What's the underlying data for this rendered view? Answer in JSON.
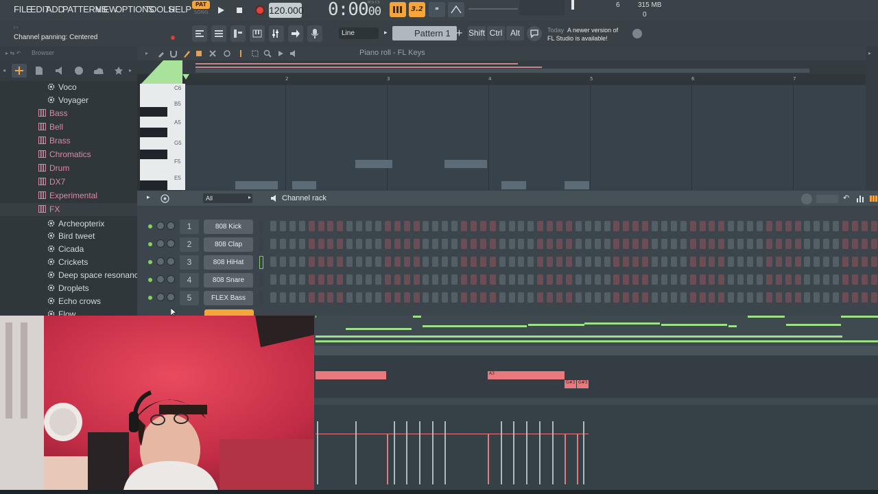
{
  "menu": [
    "FILE",
    "EDIT",
    "ADD",
    "PATTERNS",
    "VIEW",
    "OPTIONS",
    "TOOLS",
    "HELP"
  ],
  "transport": {
    "pat_label": "PAT",
    "song_label": "SONG",
    "tempo": "120.000",
    "time_main": "0:00",
    "time_ms": "00",
    "time_unit": "M:S:CS"
  },
  "toolbar_buttons": {
    "typing": "3.2",
    "wait": "⚭"
  },
  "monitor": {
    "cpu": "6",
    "memory": "315 MB",
    "polyphony": "0"
  },
  "hint": {
    "prefix": "ı  ı",
    "text": "Channel panning: Centered"
  },
  "snap": {
    "value": "Line"
  },
  "pattern": {
    "name": "Pattern 1",
    "add": "+"
  },
  "modifiers": [
    "Shift",
    "Ctrl",
    "Alt"
  ],
  "news": {
    "day": "Today",
    "line1": "A newer version of",
    "line2": "FL Studio is available!"
  },
  "browser": {
    "title": "Browser",
    "items": [
      {
        "type": "plugin",
        "label": "Voco"
      },
      {
        "type": "plugin",
        "label": "Voyager"
      },
      {
        "type": "folder",
        "label": "Bass"
      },
      {
        "type": "folder",
        "label": "Bell"
      },
      {
        "type": "folder",
        "label": "Brass"
      },
      {
        "type": "folder",
        "label": "Chromatics"
      },
      {
        "type": "folder",
        "label": "Drum"
      },
      {
        "type": "folder",
        "label": "DX7"
      },
      {
        "type": "folder",
        "label": "Experimental"
      },
      {
        "type": "folder",
        "label": "FX"
      },
      {
        "type": "plugin",
        "label": "Archeopterix"
      },
      {
        "type": "plugin",
        "label": "Bird tweet"
      },
      {
        "type": "plugin",
        "label": "Cicada"
      },
      {
        "type": "plugin",
        "label": "Crickets"
      },
      {
        "type": "plugin",
        "label": "Deep space resonance"
      },
      {
        "type": "plugin",
        "label": "Droplets"
      },
      {
        "type": "plugin",
        "label": "Echo crows"
      },
      {
        "type": "plugin",
        "label": "Flow"
      }
    ]
  },
  "piano_roll": {
    "title": "Piano roll - FL Keys",
    "bars": [
      "2",
      "3",
      "4",
      "5",
      "6",
      "7"
    ],
    "keys": [
      "C6",
      "B5",
      "A5",
      "G5",
      "F5",
      "E5"
    ]
  },
  "channel_rack": {
    "title": "Channel rack",
    "filter": "All",
    "channels": [
      {
        "num": "1",
        "name": "808 Kick"
      },
      {
        "num": "2",
        "name": "808 Clap"
      },
      {
        "num": "3",
        "name": "808 HiHat"
      },
      {
        "num": "4",
        "name": "808 Snare"
      },
      {
        "num": "5",
        "name": "FLEX Bass"
      }
    ]
  },
  "playlist": {
    "notes": [
      "A3",
      "G#3",
      "G#3"
    ]
  },
  "colors": {
    "accent": "#f6a53a",
    "led": "#86d060",
    "note": "#e87a7e",
    "folder": "#e087a6"
  }
}
